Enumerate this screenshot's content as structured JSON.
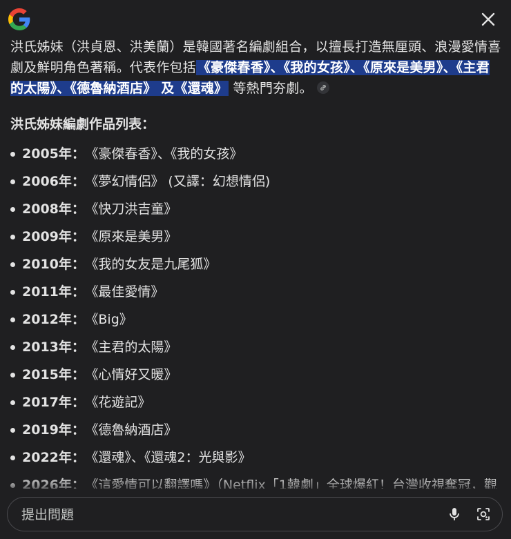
{
  "header": {
    "logo_icon": "google-g-icon",
    "close_icon": "close-icon"
  },
  "intro": {
    "text_before": "洪氏姊妹（洪貞恩、洪美蘭）是韓國著名編劇組合，以擅長打造無厘頭、浪漫愛情喜劇及鮮明角色著稱。代表作包括",
    "highlighted": "《豪傑春香》、《我的女孩》、《原來是美男》、《主君的太陽》、《德魯納酒店》 及《還魂》",
    "text_after": "等熱門夯劇。",
    "link_icon": "link-icon"
  },
  "list_heading": "洪氏姊妹編劇作品列表：",
  "works": [
    {
      "year": "2005年：",
      "title": "《豪傑春香》、《我的女孩》"
    },
    {
      "year": "2006年：",
      "title": "《夢幻情侶》 (又譯：幻想情侶)"
    },
    {
      "year": "2008年：",
      "title": "《快刀洪吉童》"
    },
    {
      "year": "2009年：",
      "title": "《原來是美男》"
    },
    {
      "year": "2010年：",
      "title": "《我的女友是九尾狐》"
    },
    {
      "year": "2011年：",
      "title": "《最佳愛情》"
    },
    {
      "year": "2012年：",
      "title": "《Big》"
    },
    {
      "year": "2013年：",
      "title": "《主君的太陽》"
    },
    {
      "year": "2015年：",
      "title": "《心情好又暖》"
    },
    {
      "year": "2017年：",
      "title": "《花遊記》"
    },
    {
      "year": "2019年：",
      "title": "《德魯納酒店》"
    },
    {
      "year": "2022年：",
      "title": "《還魂》、《還魂2：光與影》"
    },
    {
      "year": "2026年：",
      "title": "《這愛情可以翻譯嗎》（Netflix「1韓劇」全球爆紅！台灣收視奪冠，觀"
    }
  ],
  "input": {
    "placeholder": "提出問題",
    "value": "",
    "mic_icon": "microphone-icon",
    "lens_icon": "camera-search-icon"
  },
  "colors": {
    "background": "#1f1f21",
    "text": "#e3e3e3",
    "highlight": "#1e3c8c"
  }
}
